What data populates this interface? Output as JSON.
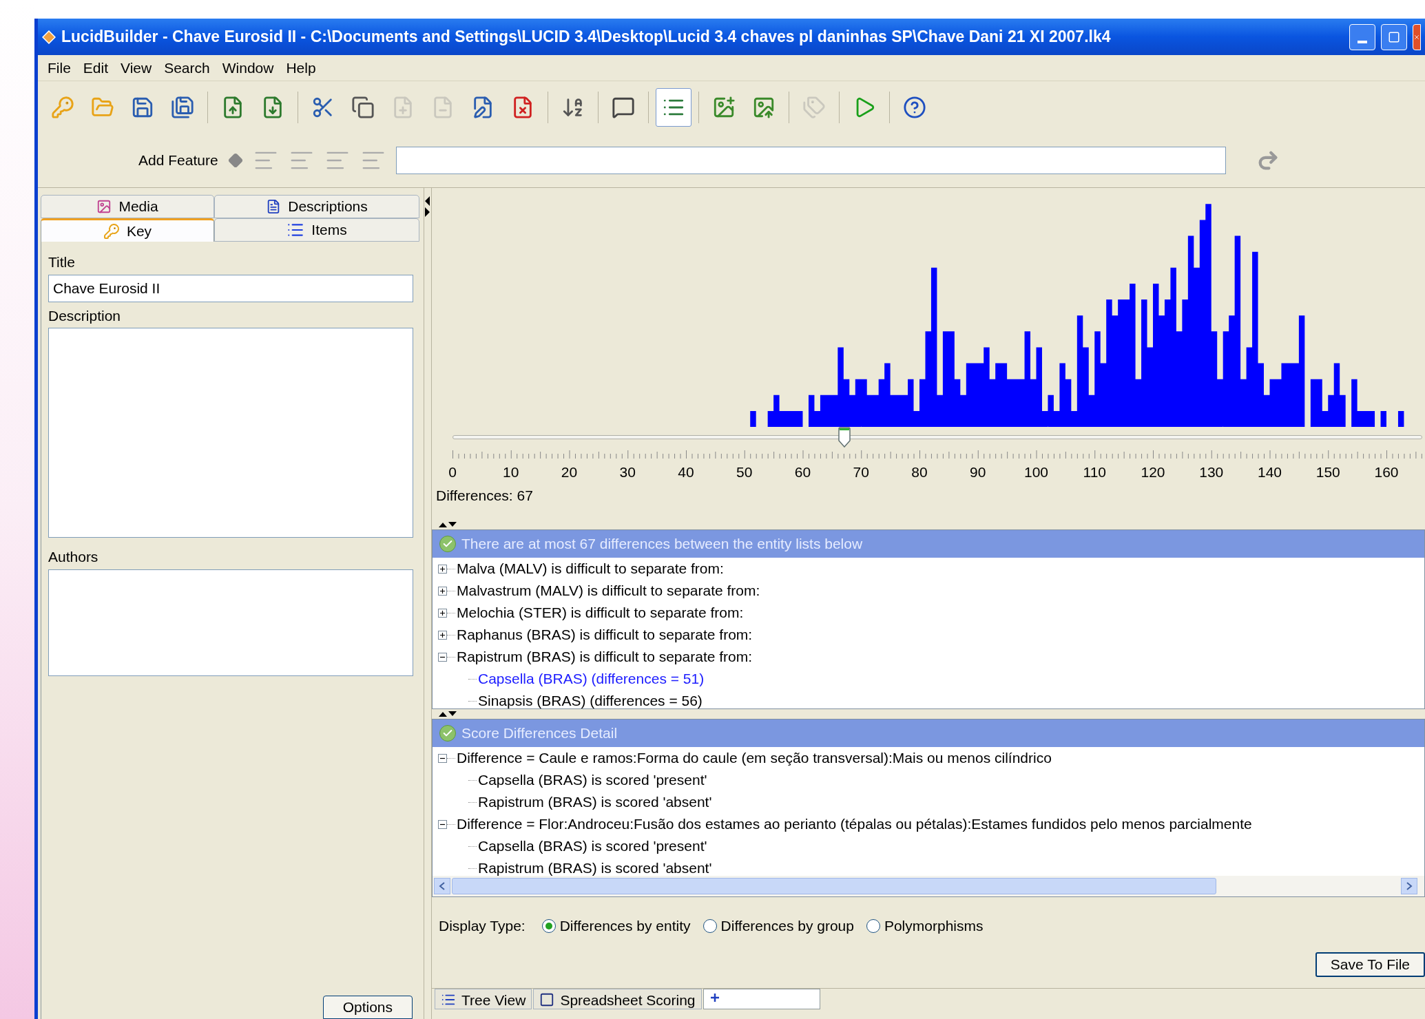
{
  "window": {
    "title": "LucidBuilder - Chave Eurosid II - C:\\Documents and Settings\\LUCID 3.4\\Desktop\\Lucid 3.4 chaves pl daninhas SP\\Chave Dani 21 XI 2007.lk4"
  },
  "menu": [
    "File",
    "Edit",
    "View",
    "Search",
    "Window",
    "Help"
  ],
  "toolbar": [
    {
      "disabled": false,
      "pressed": false
    },
    {
      "disabled": false,
      "pressed": false
    },
    {
      "disabled": false,
      "pressed": false
    },
    {
      "disabled": false,
      "pressed": false
    },
    {
      "disabled": false,
      "pressed": false
    },
    {
      "disabled": false,
      "pressed": false
    },
    {
      "disabled": false,
      "pressed": false
    },
    {
      "disabled": false,
      "pressed": false
    },
    {
      "disabled": true,
      "pressed": false
    },
    {
      "disabled": true,
      "pressed": false
    },
    {
      "disabled": false,
      "pressed": false
    },
    {
      "disabled": false,
      "pressed": false
    },
    {
      "disabled": false,
      "pressed": false
    },
    {
      "disabled": false,
      "pressed": false
    },
    {
      "disabled": false,
      "pressed": true
    },
    {
      "disabled": false,
      "pressed": false
    },
    {
      "disabled": false,
      "pressed": false
    },
    {
      "disabled": true,
      "pressed": false
    },
    {
      "disabled": false,
      "pressed": false
    },
    {
      "disabled": false,
      "pressed": false
    }
  ],
  "feature_bar": {
    "label": "Add Feature"
  },
  "left_tabs": [
    [
      {
        "label": "Media",
        "selected": false
      },
      {
        "label": "Descriptions",
        "selected": false
      }
    ],
    [
      {
        "label": "Key",
        "selected": true
      },
      {
        "label": "Items",
        "selected": false
      }
    ]
  ],
  "form": {
    "title_label": "Title",
    "title_value": "Chave Eurosid II",
    "description_label": "Description",
    "authors_label": "Authors",
    "options_button": "Options"
  },
  "histogram": {
    "axis_labels": [
      "0",
      "10",
      "20",
      "30",
      "40",
      "50",
      "60",
      "70",
      "80",
      "90",
      "100",
      "110",
      "120",
      "130",
      "140",
      "150",
      "160"
    ],
    "slider": {
      "level": 0.404
    },
    "reading": "Differences: 67"
  },
  "entity_panel": {
    "header": "There are at most 67 differences between the entity lists below",
    "items": [
      {
        "label": "Malva (MALV) is difficult to separate from:",
        "expanded": false
      },
      {
        "label": "Malvastrum (MALV) is difficult to separate from:",
        "expanded": false
      },
      {
        "label": "Melochia (STER) is difficult to separate from:",
        "expanded": false
      },
      {
        "label": "Raphanus (BRAS) is difficult to separate from:",
        "expanded": false
      },
      {
        "label": "Rapistrum (BRAS) is difficult to separate from:",
        "expanded": true,
        "children": [
          {
            "label": "Capsella (BRAS) (differences = 51)",
            "selected": true
          },
          {
            "label": "Sinapsis (BRAS) (differences = 56)",
            "selected": false
          }
        ]
      }
    ]
  },
  "detail_panel": {
    "header": "Score Differences Detail",
    "items": [
      {
        "label": "Difference = Caule e ramos:Forma do caule (em seção transversal):Mais ou menos cilíndrico",
        "expanded": true,
        "children": [
          {
            "label": "Capsella (BRAS) is scored 'present'",
            "selected": false
          },
          {
            "label": "Rapistrum (BRAS) is scored 'absent'",
            "selected": false
          }
        ]
      },
      {
        "label": "Difference = Flor:Androceu:Fusão dos estames ao perianto (tépalas ou pétalas):Estames fundidos pelo menos parcialmente",
        "expanded": true,
        "children": [
          {
            "label": "Capsella (BRAS) is scored 'present'",
            "selected": false
          },
          {
            "label": "Rapistrum (BRAS) is scored 'absent'",
            "selected": false
          }
        ]
      }
    ]
  },
  "display_type": {
    "label": "Display Type:",
    "options": [
      {
        "label": "Differences by entity",
        "selected": true
      },
      {
        "label": "Differences by group",
        "selected": false
      },
      {
        "label": "Polymorphisms",
        "selected": false
      }
    ]
  },
  "save_button": "Save To File",
  "bottom_tabs": [
    {
      "label": "Tree View",
      "selected": false
    },
    {
      "label": "Spreadsheet Scoring",
      "selected": false
    },
    {
      "selected": true
    }
  ]
}
